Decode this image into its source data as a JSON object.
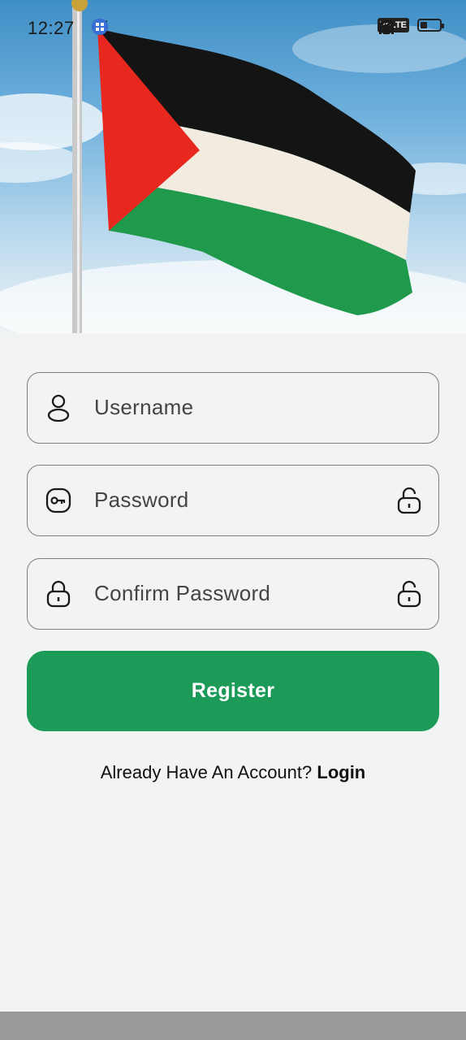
{
  "statusbar": {
    "time": "12:27",
    "volte": "VoLTE",
    "battery_level": 0.35
  },
  "form": {
    "username_placeholder": "Username",
    "password_placeholder": "Password",
    "confirm_placeholder": "Confirm Password",
    "register_label": "Register"
  },
  "footer": {
    "prompt": "Already Have An Account?",
    "login_label": "Login"
  },
  "colors": {
    "primary": "#1b9a58",
    "background": "#f2f4f3",
    "border": "#7d7f7e"
  }
}
